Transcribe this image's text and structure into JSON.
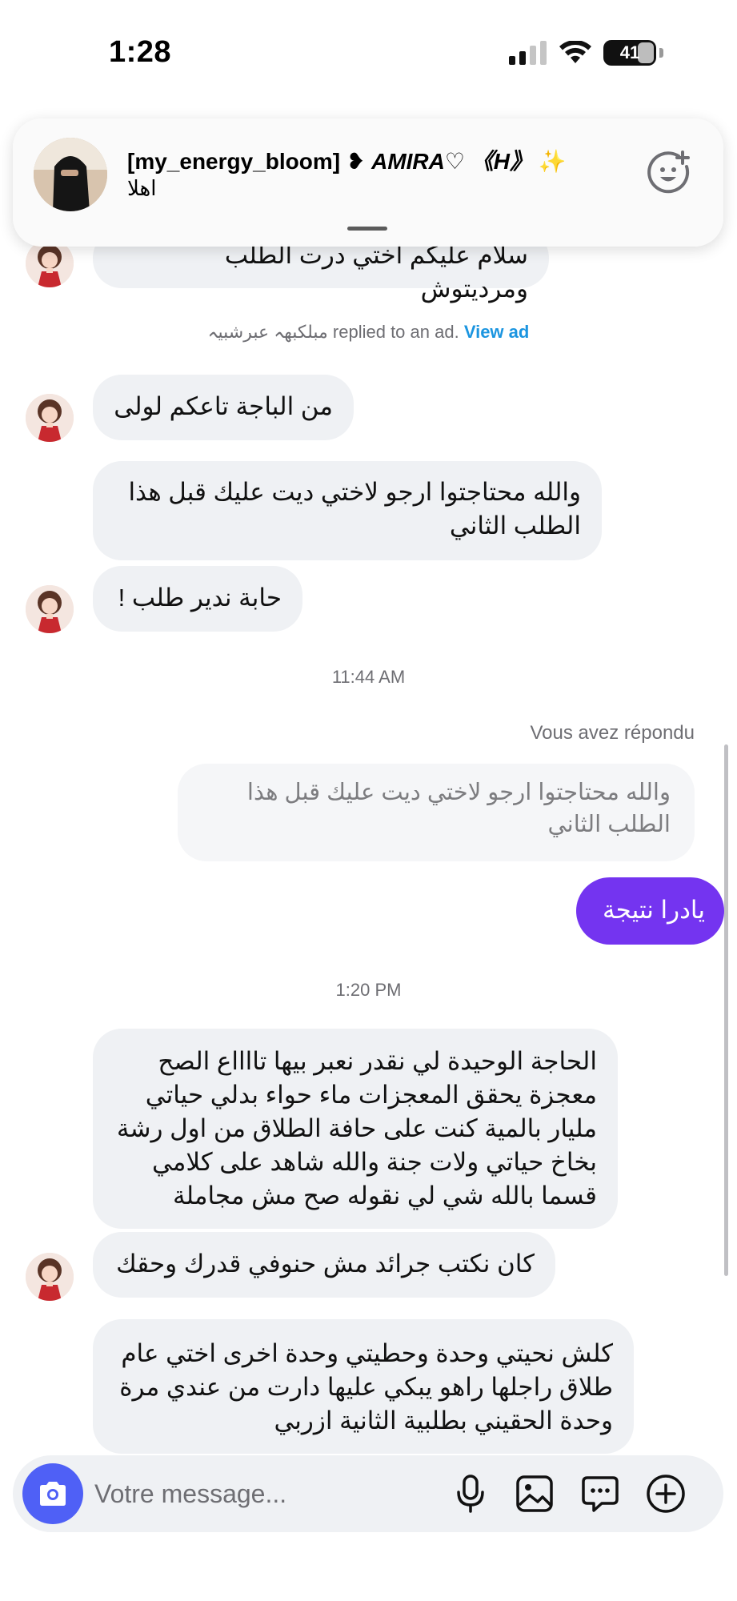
{
  "status_bar": {
    "time": "1:28",
    "battery": "41"
  },
  "notification": {
    "sender_prefix": "[my_energy_bloom] ❥ ",
    "sender_name": "AMIRA♡ 《H》",
    "sender_suffix": " ✨",
    "message": "اهلا",
    "icon": "sticker-smile-icon"
  },
  "messages": {
    "m0": "سلام عليكم اختي درت الطلب ومرديتوش",
    "ad_note": {
      "sender": "مبلكبهہ عبرشبيہ",
      "text": " replied to an ad. ",
      "link": "View ad"
    },
    "m1": "من الباجة تاعكم لولى",
    "m2": "والله محتاجتوا ارجو لاختي ديت عليك قبل هذا الطلب الثاني",
    "m3": "حابة ندير طلب !",
    "ts1": "11:44 AM",
    "reply_label": "Vous avez répondu",
    "quoted": "والله محتاجتوا ارجو لاختي ديت عليك قبل هذا الطلب الثاني",
    "sent1": "يادرا نتيجة",
    "ts2": "1:20 PM",
    "m4": "الحاجة الوحيدة لي نقدر نعبر بيها تااااع الصح معجزة يحقق المعجزات ماء حواء بدلي حياتي مليار بالمية كنت على حافة الطلاق من اول رشة بخاخ حياتي ولات جنة والله شاهد على كلامي قسما بالله شي لي نقوله صح مش مجاملة",
    "m5": "كان نكتب جرائد مش حنوفي قدرك وحقك",
    "m6": "كلش نحيتي وحدة وحطيتي وحدة اخرى اختي عام طلاق راجلها راهو يبكي عليها دارت من عندي مرة وحدة الحقيني بطلبية الثانية ازربي"
  },
  "composer": {
    "placeholder": "Votre message...",
    "icons": [
      "camera-icon",
      "microphone-icon",
      "gallery-icon",
      "sticker-chat-icon",
      "plus-circle-icon"
    ]
  },
  "colors": {
    "accent": "#7434f0",
    "bubble_in": "#eff1f4",
    "link": "#1b95e0",
    "camera": "#4f60f6"
  }
}
